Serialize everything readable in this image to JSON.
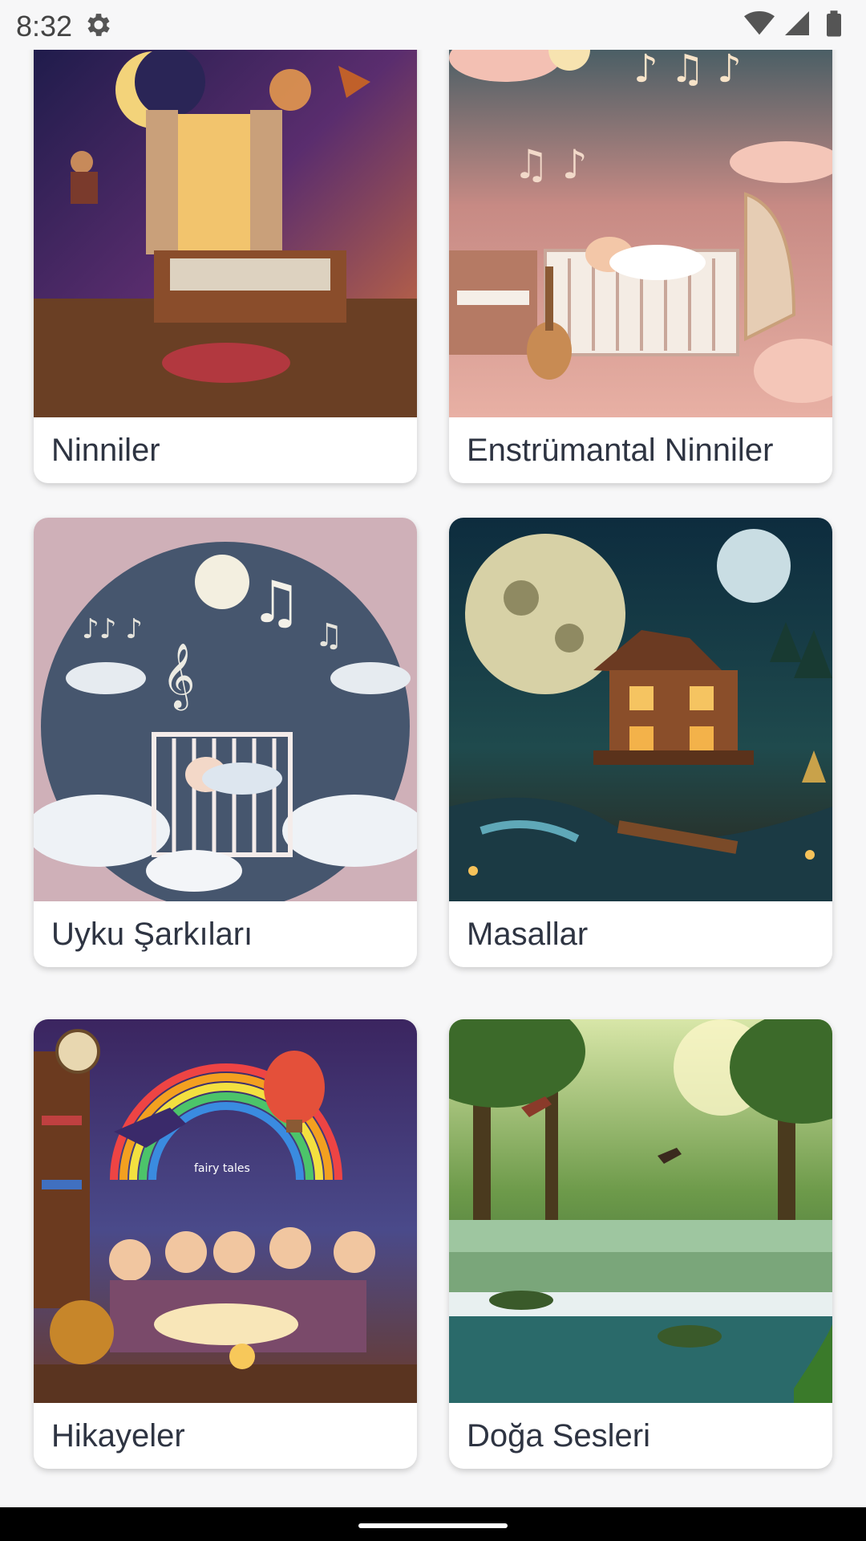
{
  "status_bar": {
    "time": "8:32",
    "icons": [
      "gear-icon",
      "wifi-icon",
      "signal-icon",
      "battery-icon"
    ]
  },
  "categories": [
    {
      "label": "Ninniler",
      "image": "night-lullaby-scene"
    },
    {
      "label": "Enstrümantal Ninniler",
      "image": "instrumental-lullaby-scene"
    },
    {
      "label": "Uyku Şarkıları",
      "image": "sleep-songs-scene"
    },
    {
      "label": "Masallar",
      "image": "fairy-house-moon-scene"
    },
    {
      "label": "Hikayeler",
      "image": "children-reading-fairy-tales-scene",
      "image_text": "fairy tales"
    },
    {
      "label": "Doğa Sesleri",
      "image": "forest-river-birds-scene"
    }
  ],
  "colors": {
    "background": "#f7f7f8",
    "card": "#ffffff",
    "label_text": "#2e3442",
    "nav_bar": "#000000"
  }
}
